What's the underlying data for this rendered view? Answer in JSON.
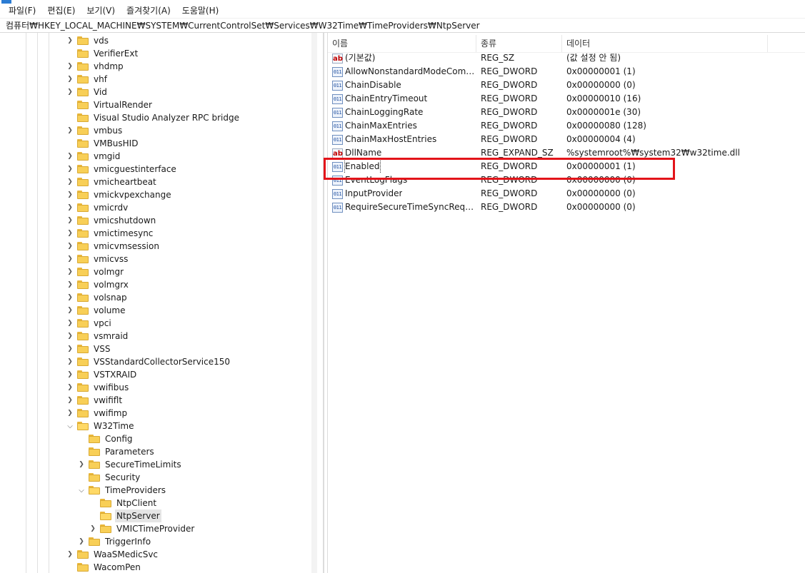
{
  "menubar": {
    "items": [
      "파일(F)",
      "편집(E)",
      "보기(V)",
      "즐겨찾기(A)",
      "도움말(H)"
    ]
  },
  "address": {
    "path": "컴퓨터₩HKEY_LOCAL_MACHINE₩SYSTEM₩CurrentControlSet₩Services₩W32Time₩TimeProviders₩NtpServer"
  },
  "tree": {
    "items": [
      {
        "label": "vds",
        "expander": "collapsed",
        "state": "closed"
      },
      {
        "label": "VerifierExt",
        "expander": "none",
        "state": "closed"
      },
      {
        "label": "vhdmp",
        "expander": "collapsed",
        "state": "closed"
      },
      {
        "label": "vhf",
        "expander": "collapsed",
        "state": "closed"
      },
      {
        "label": "Vid",
        "expander": "collapsed",
        "state": "closed"
      },
      {
        "label": "VirtualRender",
        "expander": "none",
        "state": "closed"
      },
      {
        "label": "Visual Studio Analyzer RPC bridge",
        "expander": "none",
        "state": "closed"
      },
      {
        "label": "vmbus",
        "expander": "collapsed",
        "state": "closed"
      },
      {
        "label": "VMBusHID",
        "expander": "none",
        "state": "closed"
      },
      {
        "label": "vmgid",
        "expander": "collapsed",
        "state": "closed"
      },
      {
        "label": "vmicguestinterface",
        "expander": "collapsed",
        "state": "closed"
      },
      {
        "label": "vmicheartbeat",
        "expander": "collapsed",
        "state": "closed"
      },
      {
        "label": "vmickvpexchange",
        "expander": "collapsed",
        "state": "closed"
      },
      {
        "label": "vmicrdv",
        "expander": "collapsed",
        "state": "closed"
      },
      {
        "label": "vmicshutdown",
        "expander": "collapsed",
        "state": "closed"
      },
      {
        "label": "vmictimesync",
        "expander": "collapsed",
        "state": "closed"
      },
      {
        "label": "vmicvmsession",
        "expander": "collapsed",
        "state": "closed"
      },
      {
        "label": "vmicvss",
        "expander": "collapsed",
        "state": "closed"
      },
      {
        "label": "volmgr",
        "expander": "collapsed",
        "state": "closed"
      },
      {
        "label": "volmgrx",
        "expander": "collapsed",
        "state": "closed"
      },
      {
        "label": "volsnap",
        "expander": "collapsed",
        "state": "closed"
      },
      {
        "label": "volume",
        "expander": "collapsed",
        "state": "closed"
      },
      {
        "label": "vpci",
        "expander": "collapsed",
        "state": "closed"
      },
      {
        "label": "vsmraid",
        "expander": "collapsed",
        "state": "closed"
      },
      {
        "label": "VSS",
        "expander": "collapsed",
        "state": "closed"
      },
      {
        "label": "VSStandardCollectorService150",
        "expander": "collapsed",
        "state": "closed"
      },
      {
        "label": "VSTXRAID",
        "expander": "collapsed",
        "state": "closed"
      },
      {
        "label": "vwifibus",
        "expander": "collapsed",
        "state": "closed"
      },
      {
        "label": "vwififlt",
        "expander": "collapsed",
        "state": "closed"
      },
      {
        "label": "vwifimp",
        "expander": "collapsed",
        "state": "closed"
      },
      {
        "label": "W32Time",
        "expander": "expanded",
        "state": "open"
      },
      {
        "label": "Config",
        "expander": "none",
        "state": "closed"
      },
      {
        "label": "Parameters",
        "expander": "none",
        "state": "closed"
      },
      {
        "label": "SecureTimeLimits",
        "expander": "collapsed",
        "state": "closed"
      },
      {
        "label": "Security",
        "expander": "none",
        "state": "closed"
      },
      {
        "label": "TimeProviders",
        "expander": "expanded",
        "state": "open"
      },
      {
        "label": "NtpClient",
        "expander": "none",
        "state": "closed"
      },
      {
        "label": "NtpServer",
        "expander": "none",
        "state": "selected"
      },
      {
        "label": "VMICTimeProvider",
        "expander": "collapsed",
        "state": "closed"
      },
      {
        "label": "TriggerInfo",
        "expander": "collapsed",
        "state": "closed"
      },
      {
        "label": "WaaSMedicSvc",
        "expander": "collapsed",
        "state": "closed"
      },
      {
        "label": "WacomPen",
        "expander": "none",
        "state": "closed"
      }
    ]
  },
  "values": {
    "columns": {
      "name": "이름",
      "type": "종류",
      "data": "데이터"
    },
    "rows": [
      {
        "icon": "string-value-icon",
        "name": "(기본값)",
        "type": "REG_SZ",
        "data": "(값 설정 안 됨)"
      },
      {
        "icon": "dword-value-icon",
        "name": "AllowNonstandardModeCombin...",
        "type": "REG_DWORD",
        "data": "0x00000001 (1)"
      },
      {
        "icon": "dword-value-icon",
        "name": "ChainDisable",
        "type": "REG_DWORD",
        "data": "0x00000000 (0)"
      },
      {
        "icon": "dword-value-icon",
        "name": "ChainEntryTimeout",
        "type": "REG_DWORD",
        "data": "0x00000010 (16)"
      },
      {
        "icon": "dword-value-icon",
        "name": "ChainLoggingRate",
        "type": "REG_DWORD",
        "data": "0x0000001e (30)"
      },
      {
        "icon": "dword-value-icon",
        "name": "ChainMaxEntries",
        "type": "REG_DWORD",
        "data": "0x00000080 (128)"
      },
      {
        "icon": "dword-value-icon",
        "name": "ChainMaxHostEntries",
        "type": "REG_DWORD",
        "data": "0x00000004 (4)"
      },
      {
        "icon": "string-value-icon",
        "name": "DllName",
        "type": "REG_EXPAND_SZ",
        "data": "%systemroot%₩system32₩w32time.dll"
      },
      {
        "icon": "dword-value-icon",
        "name": "Enabled",
        "type": "REG_DWORD",
        "data": "0x00000001 (1)",
        "focused": true
      },
      {
        "icon": "dword-value-icon",
        "name": "EventLogFlags",
        "type": "REG_DWORD",
        "data": "0x00000000 (0)"
      },
      {
        "icon": "dword-value-icon",
        "name": "InputProvider",
        "type": "REG_DWORD",
        "data": "0x00000000 (0)"
      },
      {
        "icon": "dword-value-icon",
        "name": "RequireSecureTimeSyncRequests",
        "type": "REG_DWORD",
        "data": "0x00000000 (0)"
      }
    ]
  },
  "icon_glyphs": {
    "string": "ab",
    "dword": "011"
  },
  "colors": {
    "highlight_border": "#e3141a",
    "folder": "#f8cf57",
    "selection": "#e5e5e5"
  }
}
